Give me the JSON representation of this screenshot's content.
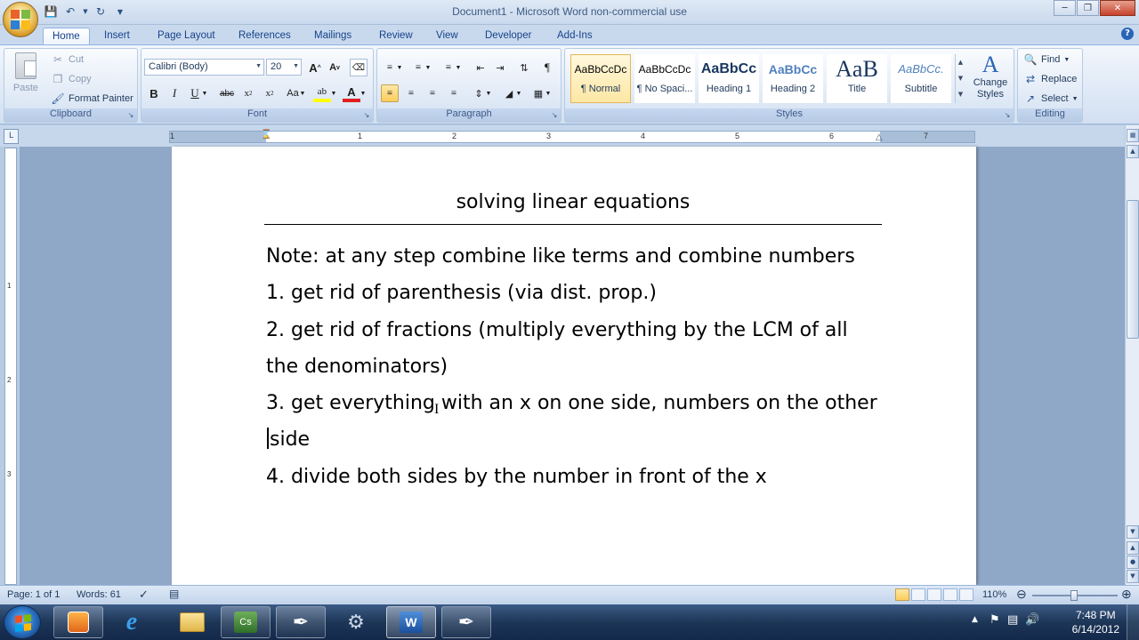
{
  "window": {
    "title": "Document1 - Microsoft Word non-commercial use",
    "controls": [
      "minimize",
      "restore",
      "close"
    ]
  },
  "tabs": [
    "Home",
    "Insert",
    "Page Layout",
    "References",
    "Mailings",
    "Review",
    "View",
    "Developer",
    "Add-Ins"
  ],
  "active_tab": "Home",
  "ribbon": {
    "clipboard": {
      "label": "Clipboard",
      "paste": "Paste",
      "cut": "Cut",
      "copy": "Copy",
      "format_painter": "Format Painter"
    },
    "font": {
      "label": "Font",
      "font_name": "Calibri (Body)",
      "font_size": "20"
    },
    "paragraph": {
      "label": "Paragraph"
    },
    "styles": {
      "label": "Styles",
      "items": [
        {
          "sample": "AaBbCcDc",
          "name": "¶ Normal"
        },
        {
          "sample": "AaBbCcDc",
          "name": "¶ No Spaci..."
        },
        {
          "sample": "AaBbCc",
          "name": "Heading 1"
        },
        {
          "sample": "AaBbCc",
          "name": "Heading 2"
        },
        {
          "sample": "AaB",
          "name": "Title"
        },
        {
          "sample": "AaBbCc.",
          "name": "Subtitle"
        }
      ],
      "change_styles": "Change Styles"
    },
    "editing": {
      "label": "Editing",
      "find": "Find",
      "replace": "Replace",
      "select": "Select"
    }
  },
  "ruler": {
    "h_numbers": [
      "1",
      "1",
      "2",
      "3",
      "4",
      "5",
      "6",
      "7"
    ],
    "v_numbers": [
      "1",
      "2",
      "3"
    ]
  },
  "document": {
    "title": "solving linear equations",
    "note": "Note: at any step combine like terms and combine numbers",
    "step1": "1.  get rid of parenthesis (via dist. prop.)",
    "step2": "2.  get rid of fractions (multiply everything by the LCM of all the denominators)",
    "step3_before_caret": "3.  get everything with an x on one side, numbers on the other",
    "step3_after_caret": "side",
    "step4": "4.  divide both sides by the number in front of the x"
  },
  "status": {
    "page": "Page: 1 of 1",
    "words": "Words: 61",
    "zoom": "110%"
  },
  "taskbar": {
    "time": "7:48 PM",
    "date": "6/14/2012"
  },
  "colors": {
    "ribbon_bg": "#dfe9f6",
    "accent": "#15428b",
    "selected_style": "#fde7a3",
    "taskbar": "#1d3657"
  }
}
